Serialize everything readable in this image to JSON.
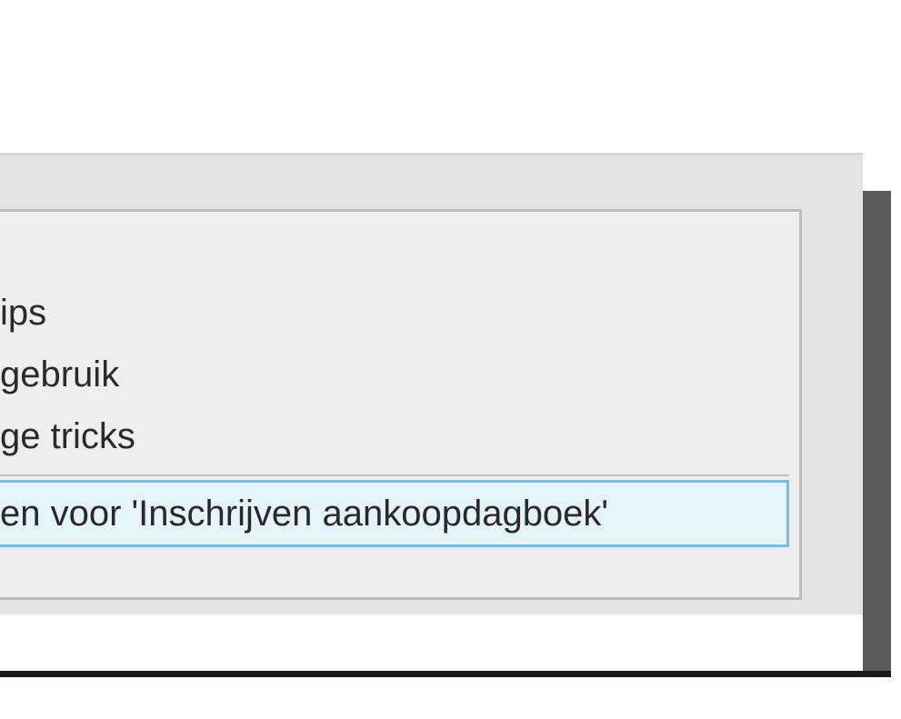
{
  "menu": {
    "items": [
      {
        "label": "ips"
      },
      {
        "label": "gebruik"
      },
      {
        "label": "ge tricks"
      }
    ],
    "selected": {
      "label": "en voor 'Inschrijven aankoopdagboek'"
    }
  }
}
